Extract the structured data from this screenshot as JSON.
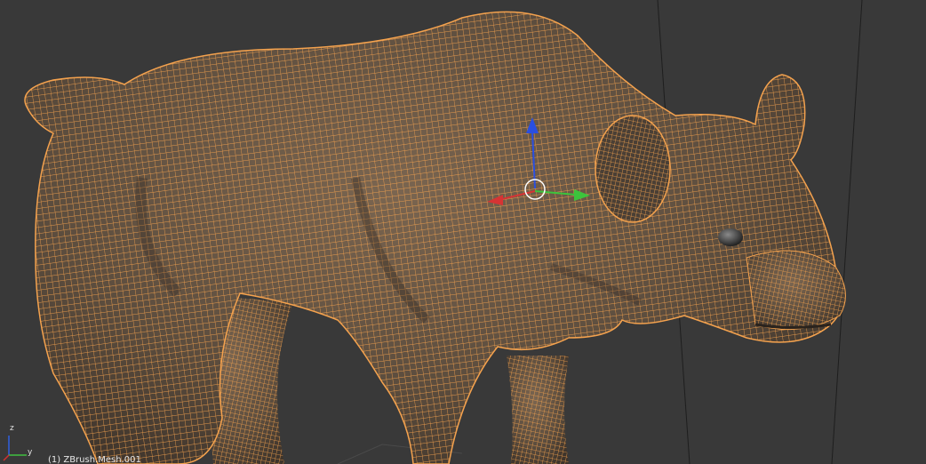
{
  "viewport": {
    "object_label": "(1) ZBrush.Mesh.001",
    "axis": {
      "z_label": "z",
      "y_label": "y"
    },
    "colors": {
      "background": "#393939",
      "wire": "#f4a24e",
      "shading": "#5a4d40",
      "gizmo_x": "#d63434",
      "gizmo_y": "#3cc43c",
      "gizmo_z": "#2a4fe0",
      "gizmo_center": "#ffffff"
    },
    "model_description": "bear"
  }
}
